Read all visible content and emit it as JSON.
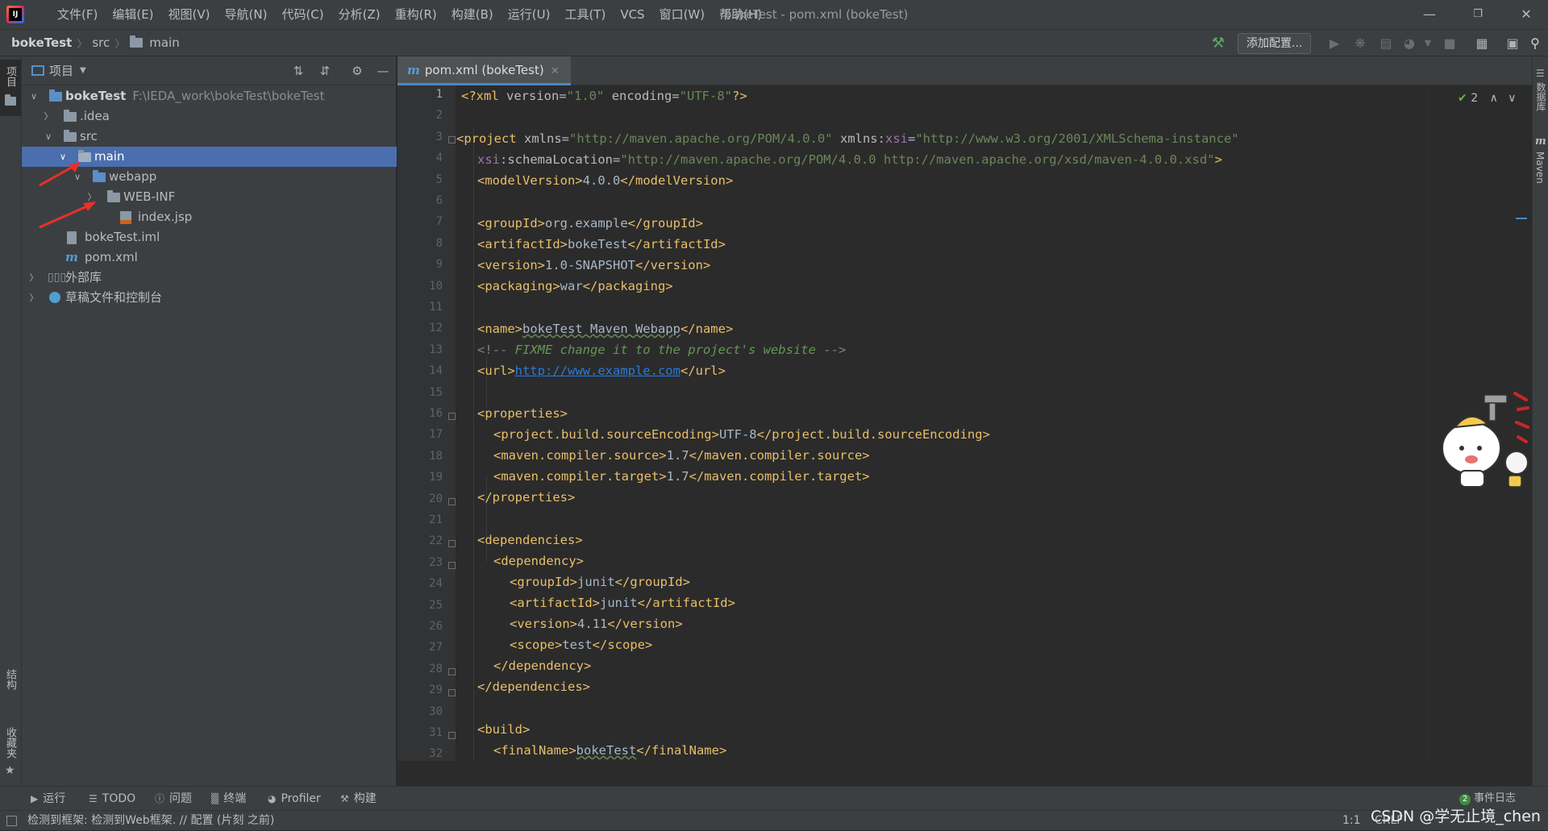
{
  "menu": [
    "文件(F)",
    "编辑(E)",
    "视图(V)",
    "导航(N)",
    "代码(C)",
    "分析(Z)",
    "重构(R)",
    "构建(B)",
    "运行(U)",
    "工具(T)",
    "VCS",
    "窗口(W)",
    "帮助(H)"
  ],
  "window_title": "bokeTest - pom.xml (bokeTest)",
  "breadcrumb": {
    "project": "bokeTest",
    "src": "src",
    "main": "main"
  },
  "toolbar": {
    "add_config": "添加配置..."
  },
  "left_strip": {
    "project_tab": "项目",
    "structure_tab": "结构",
    "favorites_tab": "收藏夹"
  },
  "project_panel": {
    "title": "项目",
    "tree": [
      {
        "label": "bokeTest",
        "path": "F:\\IEDA_work\\bokeTest\\bokeTest"
      },
      {
        "label": ".idea"
      },
      {
        "label": "src"
      },
      {
        "label": "main"
      },
      {
        "label": "webapp"
      },
      {
        "label": "WEB-INF"
      },
      {
        "label": "index.jsp"
      },
      {
        "label": "bokeTest.iml"
      },
      {
        "label": "pom.xml"
      },
      {
        "label": "外部库"
      },
      {
        "label": "草稿文件和控制台"
      }
    ]
  },
  "editor": {
    "tab_label": "pom.xml (bokeTest)",
    "inspection_count": "2",
    "line_numbers": [
      "1",
      "2",
      "3",
      "4",
      "5",
      "6",
      "7",
      "8",
      "9",
      "10",
      "11",
      "12",
      "13",
      "14",
      "15",
      "16",
      "17",
      "18",
      "19",
      "20",
      "21",
      "22",
      "23",
      "24",
      "25",
      "26",
      "27",
      "28",
      "29",
      "30",
      "31",
      "32"
    ],
    "xml": {
      "version_attr": "version",
      "version_val": "\"1.0\"",
      "encoding_attr": "encoding",
      "encoding_val": "\"UTF-8\"",
      "xmlns_val": "\"http://maven.apache.org/POM/4.0.0\"",
      "xsi_ns_val": "\"http://www.w3.org/2001/XMLSchema-instance\"",
      "schema_location_val": "\"http://maven.apache.org/POM/4.0.0 http://maven.apache.org/xsd/maven-4.0.0.xsd\"",
      "model_version": "4.0.0",
      "group_id": "org.example",
      "artifact_id": "bokeTest",
      "version": "1.0-SNAPSHOT",
      "packaging": "war",
      "name": "bokeTest Maven Webapp",
      "comment": "FIXME change it to the project's website",
      "url": "http://www.example.com",
      "source_encoding": "UTF-8",
      "compiler_source": "1.7",
      "compiler_target": "1.7",
      "dep_group_id": "junit",
      "dep_artifact_id": "junit",
      "dep_version": "4.11",
      "dep_scope": "test",
      "final_name": "bokeTest"
    }
  },
  "right_strip": {
    "database_tab": "数据库",
    "maven_tab": "Maven"
  },
  "bottom_tools": [
    "运行",
    "TODO",
    "问题",
    "终端",
    "Profiler",
    "构建"
  ],
  "event_log": {
    "count": "2",
    "label": "事件日志"
  },
  "status": {
    "message": "检测到框架: 检测到Web框架. // 配置 (片刻 之前)",
    "position": "1:1",
    "line_sep": "CRLF"
  },
  "watermark": "CSDN @学无止境_chen",
  "colors": {
    "accent": "#4b6eaf",
    "tag": "#e8bf6a",
    "string": "#6a8759",
    "comment": "#629755"
  }
}
